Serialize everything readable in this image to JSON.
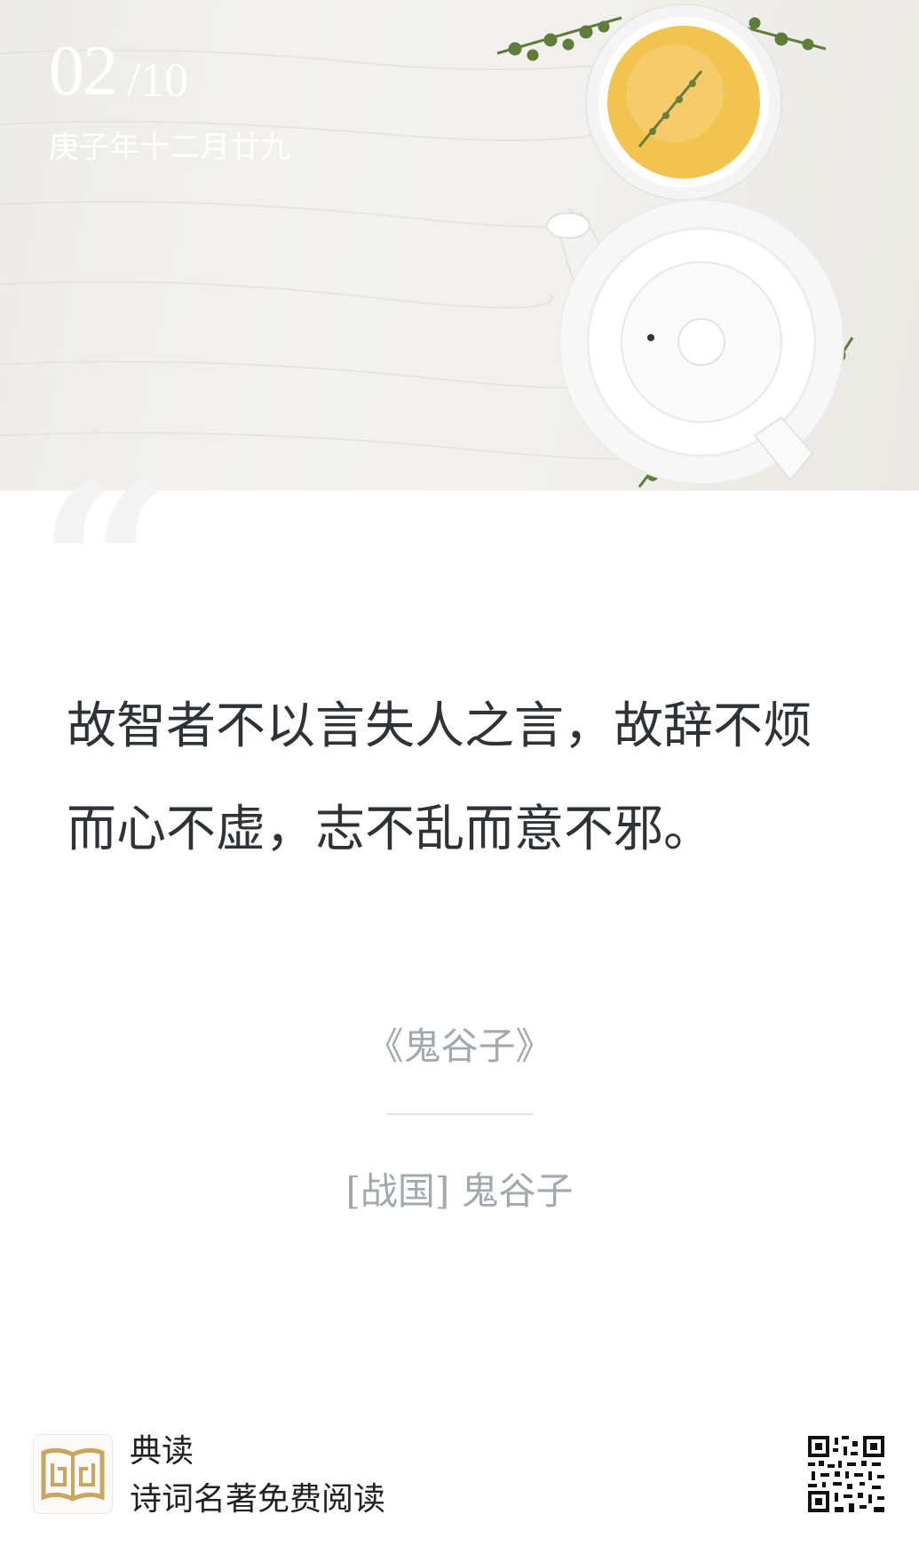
{
  "header": {
    "day": "02",
    "month": "/10",
    "lunar_date": "庚子年十二月廿九"
  },
  "quote": {
    "mark": "“",
    "line1": "故智者不以言失人之言，故辞不烦",
    "line2": "而心不虚，志不乱而意不邪。"
  },
  "source": {
    "book": "《鬼谷子》",
    "author": "[战国] 鬼谷子"
  },
  "footer": {
    "app_name": "典读",
    "slogan": "诗词名著免费阅读",
    "logo_icon": "book-logo-icon",
    "qr_icon": "qr-code-icon"
  },
  "colors": {
    "quote_text": "#2f3236",
    "meta_text": "#a3a8ae",
    "logo_gold": "#c9a560",
    "tea": "#f3c350",
    "herb": "#5f7d3a"
  }
}
